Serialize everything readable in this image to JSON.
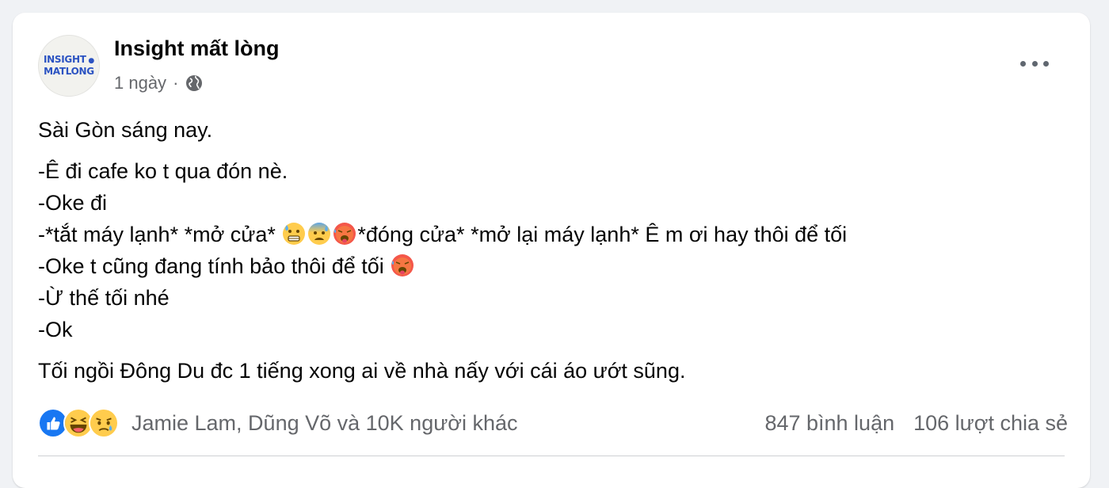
{
  "post": {
    "author": "Insight mất lòng",
    "avatar_line1": "INSIGHT",
    "avatar_line2": "MATLONG",
    "time": "1 ngày",
    "separator": "·",
    "privacy_icon": "globe-icon",
    "more_icon": "more-horizontal-icon"
  },
  "content": {
    "p1": "Sài Gòn sáng nay.",
    "l1": "-Ê đi cafe ko t qua đón nè.",
    "l2": "-Oke đi",
    "l3a": "-*tắt máy lạnh* *mở cửa* ",
    "l3b": "*đóng cửa* *mở lại máy lạnh* Ê m ơi hay thôi để tối",
    "l4": "-Oke t cũng đang tính bảo thôi để tối ",
    "l5": "-Ừ thế tối nhé",
    "l6": "-Ok",
    "p3": "Tối ngồi Đông Du đc 1 tiếng xong ai về nhà nấy với cái áo ướt sũng."
  },
  "emoji_icons": [
    "grimacing-sweat-icon",
    "anxious-sweat-icon",
    "hot-face-icon",
    "hot-face-icon"
  ],
  "stats": {
    "reaction_icons": [
      "like-icon",
      "haha-icon",
      "sad-icon"
    ],
    "people": "Jamie Lam, Dũng Võ và 10K người khác",
    "comments": "847 bình luận",
    "shares": "106 lượt chia sẻ"
  },
  "colors": {
    "accent": "#1877f2",
    "secondary_text": "#65676b",
    "avatar_text": "#2b53c2"
  }
}
